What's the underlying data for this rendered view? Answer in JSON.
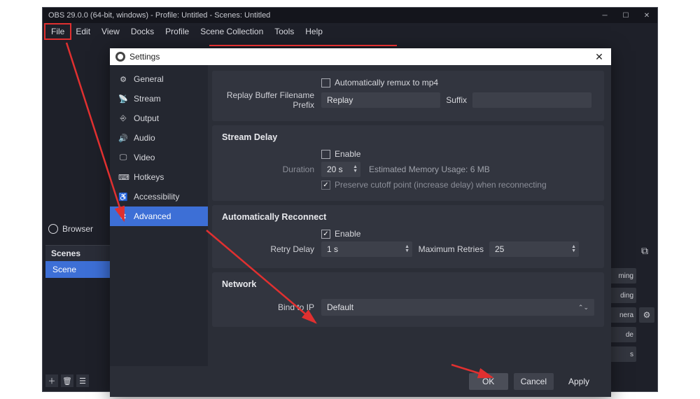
{
  "window": {
    "title": "OBS 29.0.0 (64-bit, windows) - Profile: Untitled - Scenes: Untitled"
  },
  "menubar": [
    "File",
    "Edit",
    "View",
    "Docks",
    "Profile",
    "Scene Collection",
    "Tools",
    "Help"
  ],
  "dock": {
    "browser": "Browser"
  },
  "scenes": {
    "header": "Scenes",
    "items": [
      "Scene"
    ]
  },
  "right_buttons": [
    "ming",
    "ding",
    "nera",
    "de",
    "s"
  ],
  "dialog": {
    "title": "Settings",
    "sidebar": [
      {
        "icon": "⚙",
        "label": "General",
        "name": "general"
      },
      {
        "icon": "📡",
        "label": "Stream",
        "name": "stream"
      },
      {
        "icon": "⎆",
        "label": "Output",
        "name": "output"
      },
      {
        "icon": "🔊",
        "label": "Audio",
        "name": "audio"
      },
      {
        "icon": "🖵",
        "label": "Video",
        "name": "video"
      },
      {
        "icon": "⌨",
        "label": "Hotkeys",
        "name": "hotkeys"
      },
      {
        "icon": "♿",
        "label": "Accessibility",
        "name": "accessibility"
      },
      {
        "icon": "✖",
        "label": "Advanced",
        "name": "advanced"
      }
    ],
    "top": {
      "auto_remux_label": "Automatically remux to mp4",
      "prefix_label": "Replay Buffer Filename Prefix",
      "prefix_value": "Replay",
      "suffix_label": "Suffix"
    },
    "stream_delay": {
      "title": "Stream Delay",
      "enable_label": "Enable",
      "duration_label": "Duration",
      "duration_value": "20 s",
      "memory_text": "Estimated Memory Usage: 6 MB",
      "preserve_label": "Preserve cutoff point (increase delay) when reconnecting"
    },
    "auto_reconnect": {
      "title": "Automatically Reconnect",
      "enable_label": "Enable",
      "retry_label": "Retry Delay",
      "retry_value": "1 s",
      "max_label": "Maximum Retries",
      "max_value": "25"
    },
    "network": {
      "title": "Network",
      "bind_label": "Bind to IP",
      "bind_value": "Default"
    },
    "buttons": {
      "ok": "OK",
      "cancel": "Cancel",
      "apply": "Apply"
    }
  }
}
